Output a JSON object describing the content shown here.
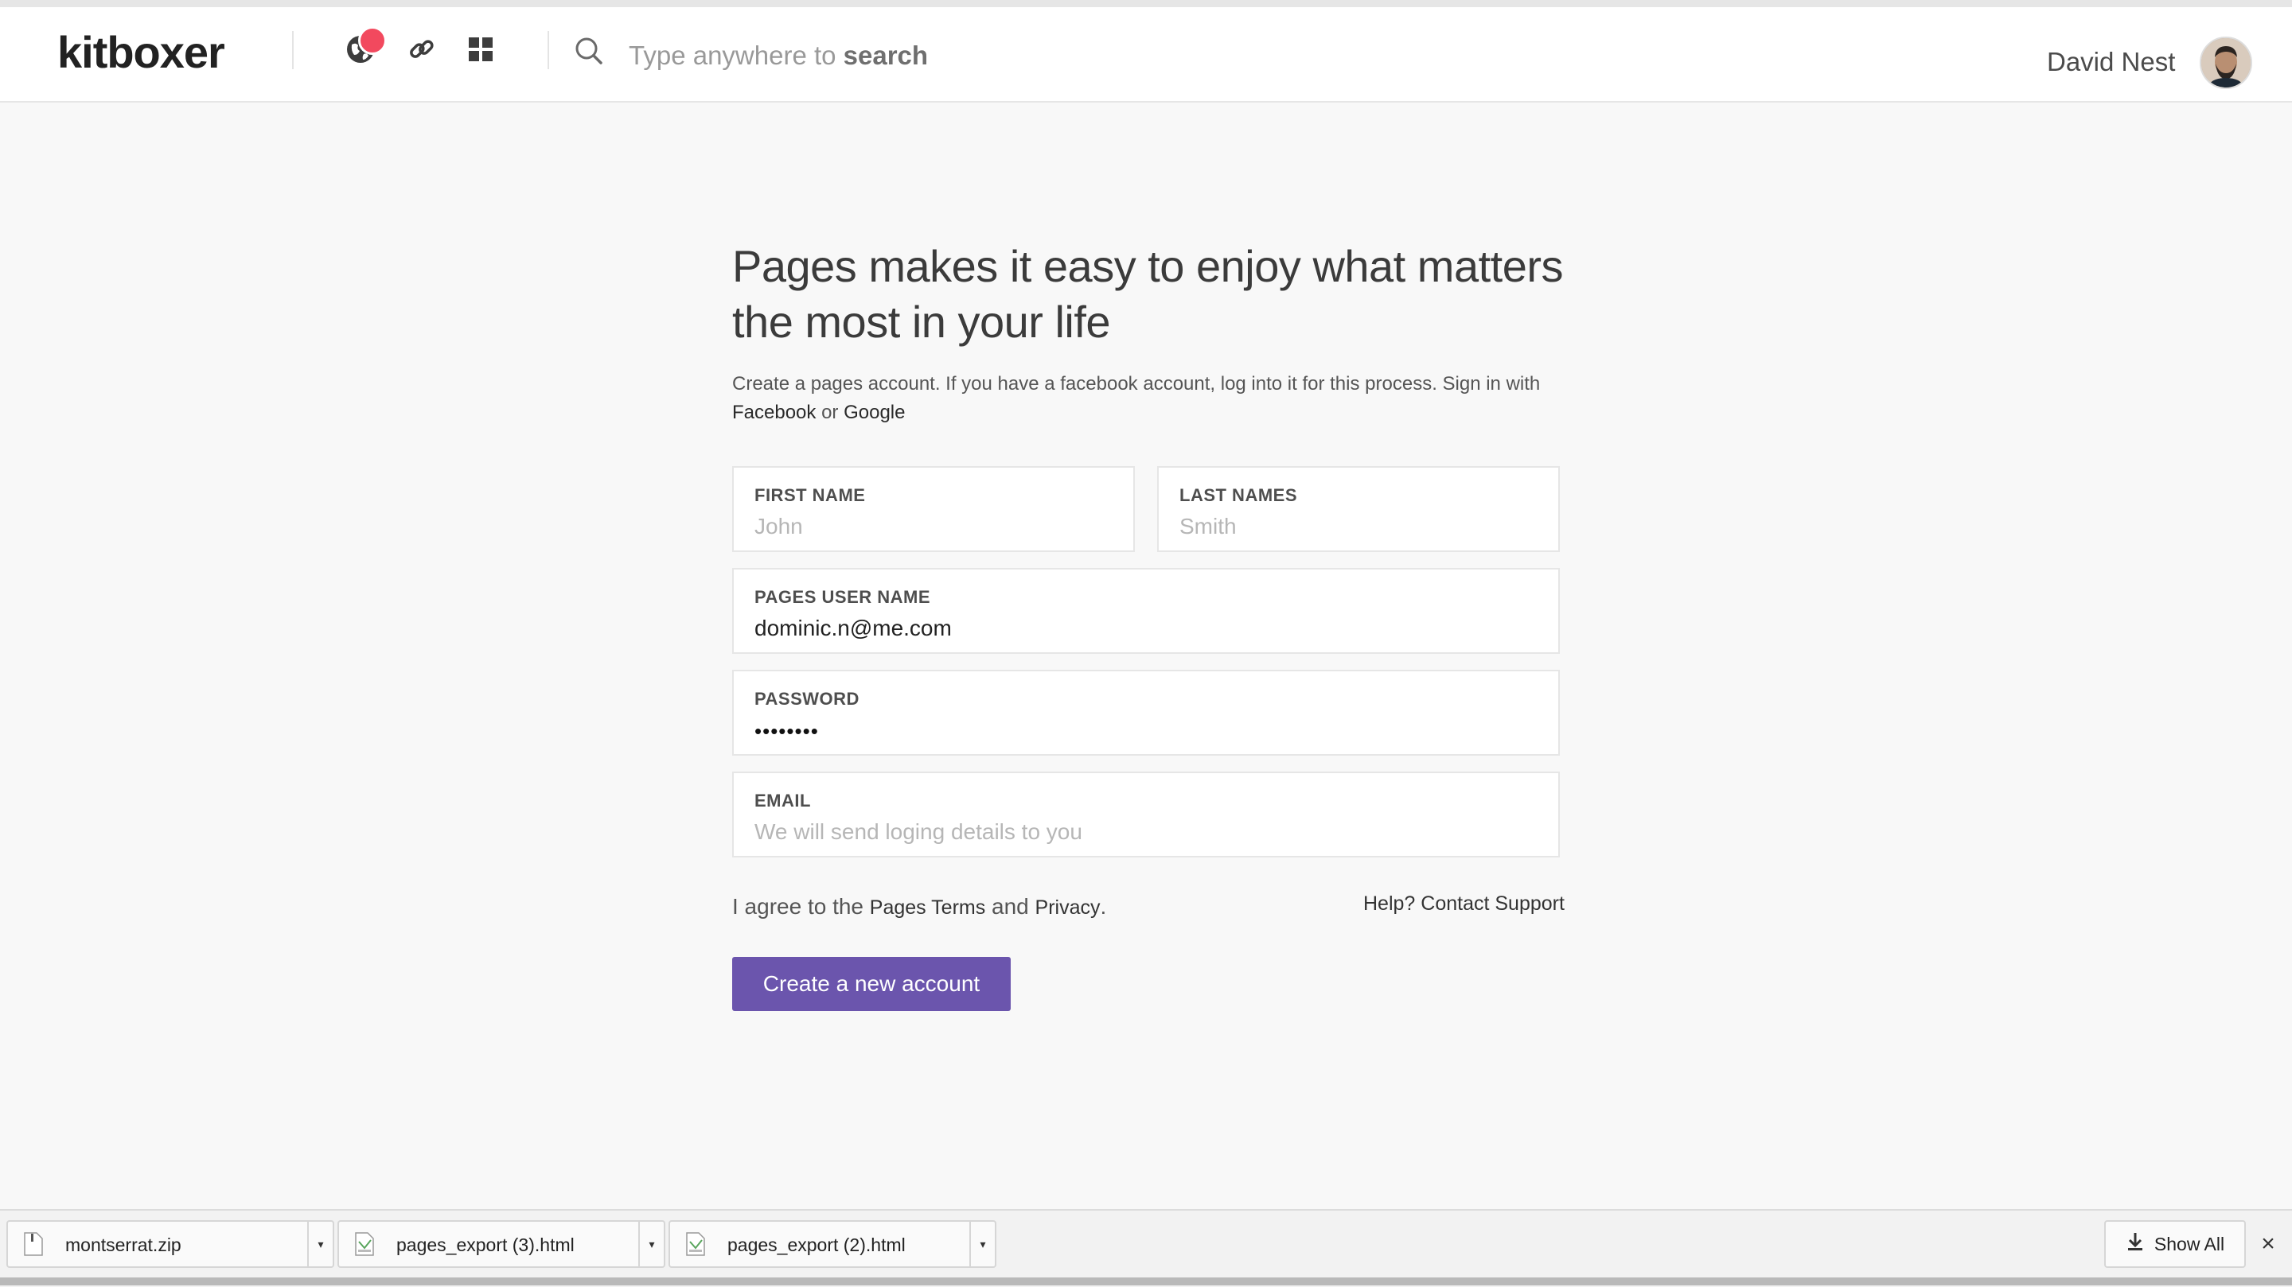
{
  "header": {
    "logo": "kitboxer",
    "search_placeholder_prefix": "Type anywhere to ",
    "search_placeholder_bold": "search",
    "user_name": "David Nest",
    "icons": [
      "globe-icon",
      "link-icon",
      "grid-icon",
      "search-icon"
    ],
    "notification_color": "#f2495e"
  },
  "form": {
    "title_line1": "Pages makes it easy to enjoy what matters",
    "title_line2": "the most in your life",
    "intro_text": "Create a pages account. If you have a facebook account, log into it for this process. Sign in with",
    "intro_facebook": "Facebook",
    "intro_or": " or ",
    "intro_google": "Google",
    "first_name": {
      "label": "FIRST NAME",
      "placeholder": "John"
    },
    "last_names": {
      "label": "LAST NAMES",
      "placeholder": "Smith"
    },
    "user_name": {
      "label": "PAGES USER NAME",
      "value": "dominic.n@me.com"
    },
    "password": {
      "label": "PASSWORD",
      "value": "••••••••"
    },
    "email": {
      "label": "EMAIL",
      "placeholder": "We will send loging details to you"
    },
    "agree_prefix": "I agree to the ",
    "agree_terms": "Pages Terms",
    "agree_and": " and ",
    "agree_privacy": "Privacy",
    "agree_suffix": ".",
    "help_prefix": "Help? ",
    "help_link": "Contact Support",
    "submit_label": "Create a new account",
    "accent_color": "#6b55ad"
  },
  "downloads": {
    "items": [
      {
        "name": "montserrat.zip"
      },
      {
        "name": "pages_export (3).html"
      },
      {
        "name": "pages_export (2).html"
      }
    ],
    "show_all": "Show All",
    "close": "×"
  }
}
